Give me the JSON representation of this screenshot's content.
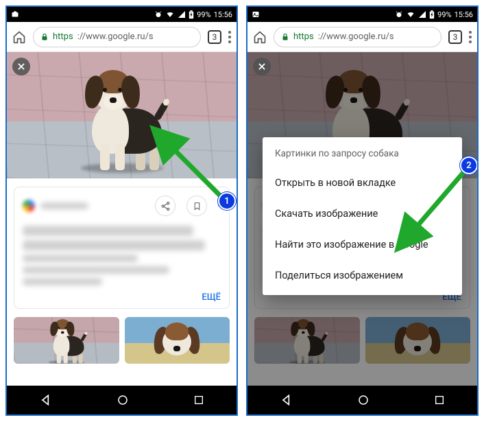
{
  "status": {
    "battery_percent": "99%",
    "time": "15:56"
  },
  "chrome": {
    "url_scheme": "https",
    "url_rest": "://www.google.ru/s",
    "tab_count": "3"
  },
  "card": {
    "more_label": "ЕЩЁ"
  },
  "context_menu": {
    "title": "Картинки по запросу собака",
    "items": [
      "Открыть в новой вкладке",
      "Скачать изображение",
      "Найти это изображение в Google",
      "Поделиться изображением"
    ]
  },
  "annotations": {
    "step1": "1",
    "step2": "2"
  }
}
